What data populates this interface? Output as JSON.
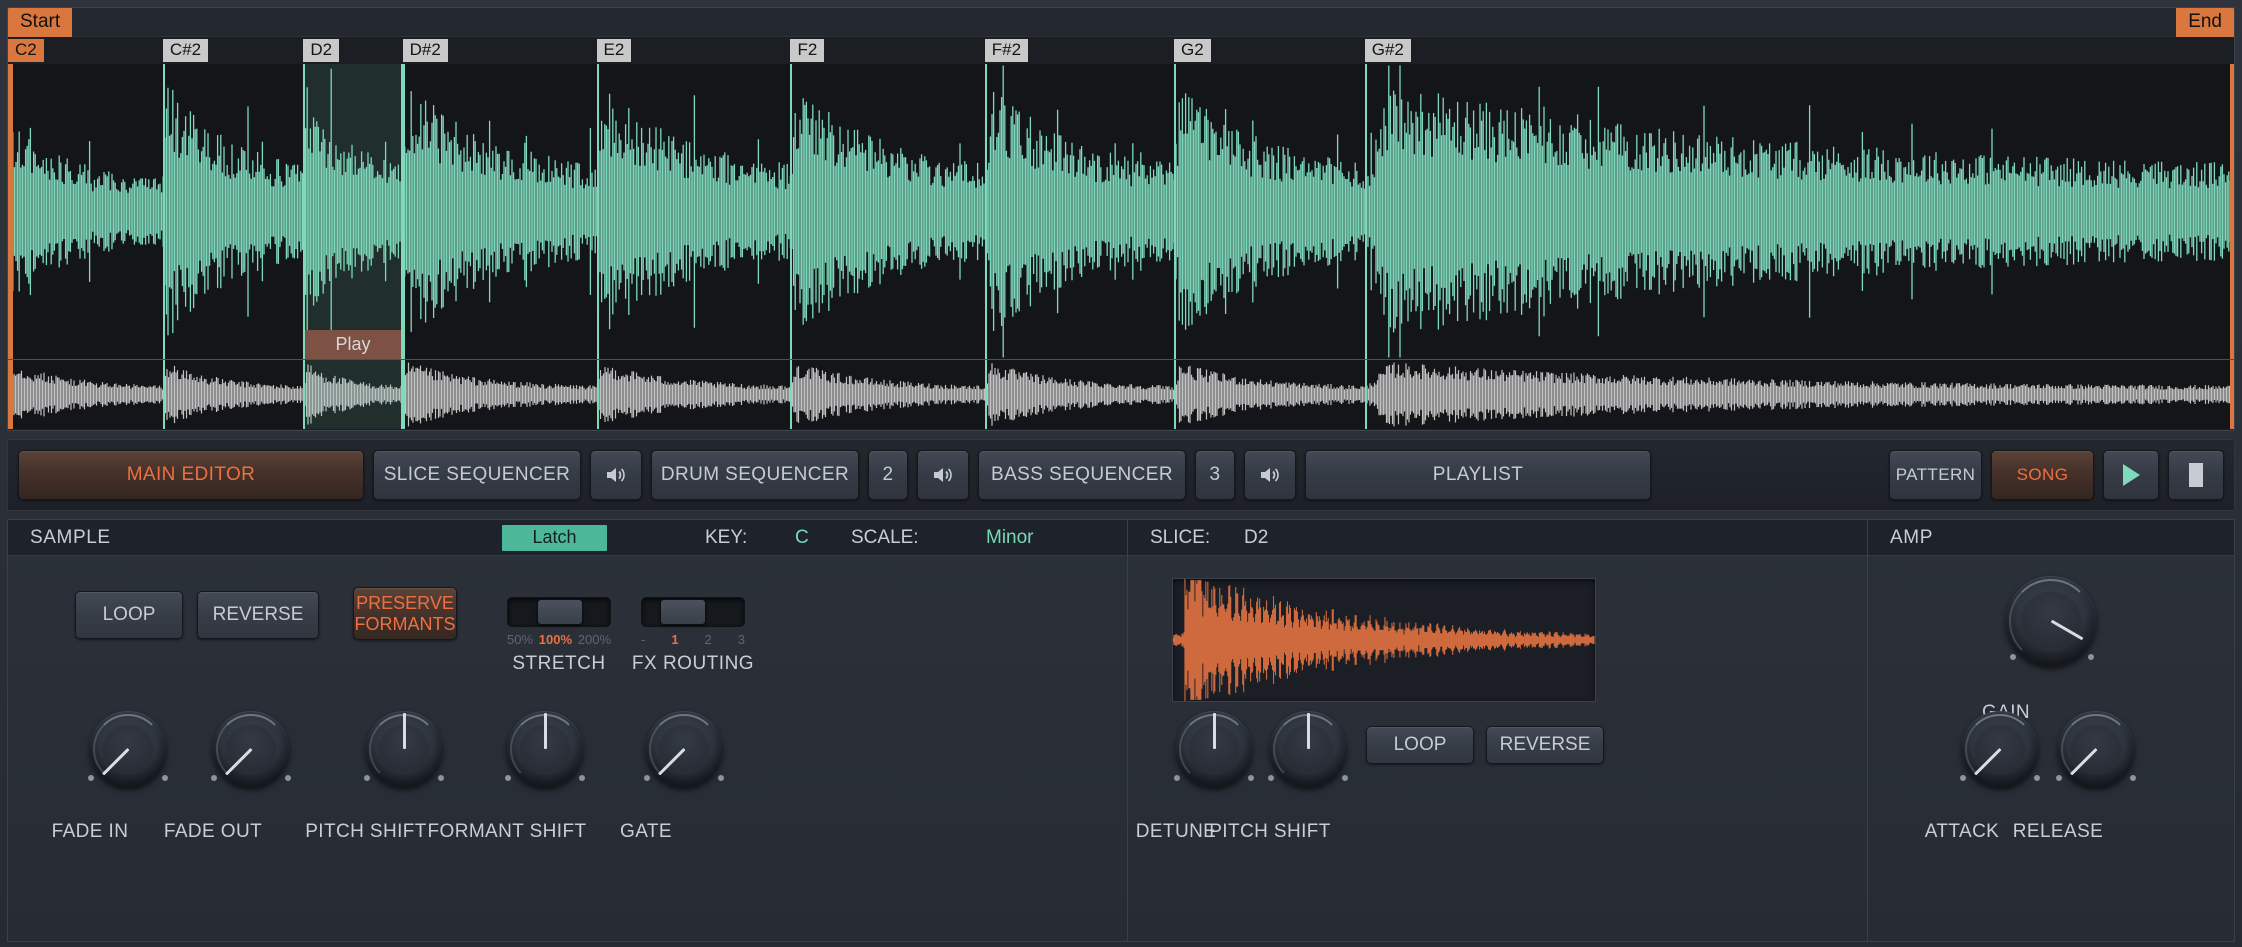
{
  "colors": {
    "accent_orange": "#d9773f",
    "accent_orange_text": "#ec7041",
    "accent_teal": "#7fd9bb",
    "latch_green": "#4db79a",
    "waveform_teal": "#7fd9bb",
    "waveform_gray": "#c3c3c3",
    "slice_wave_orange": "#cf6a3e",
    "panel_bg": "#2b3039",
    "wave_bg": "#131518"
  },
  "waveform": {
    "start_label": "Start",
    "end_label": "End",
    "play_label": "Play",
    "slices": [
      {
        "label": "C2",
        "pos_pct": 0.0,
        "active": true
      },
      {
        "label": "C#2",
        "pos_pct": 6.96,
        "active": false
      },
      {
        "label": "D2",
        "pos_pct": 13.27,
        "active": false
      },
      {
        "label": "D#2",
        "pos_pct": 17.73,
        "active": false
      },
      {
        "label": "E2",
        "pos_pct": 26.44,
        "active": false
      },
      {
        "label": "F2",
        "pos_pct": 35.15,
        "active": false
      },
      {
        "label": "F#2",
        "pos_pct": 43.88,
        "active": false
      },
      {
        "label": "G2",
        "pos_pct": 52.38,
        "active": false
      },
      {
        "label": "G#2",
        "pos_pct": 60.95,
        "active": false
      }
    ],
    "selection": {
      "start_pct": 13.27,
      "end_pct": 17.73
    }
  },
  "toolbar": {
    "tabs": [
      {
        "label": "MAIN EDITOR",
        "active": true,
        "kind": "wide"
      },
      {
        "label": "SLICE SEQUENCER",
        "active": false,
        "kind": "mid"
      },
      {
        "label": "DRUM SEQUENCER",
        "active": false,
        "kind": "mid"
      },
      {
        "label": "BASS SEQUENCER",
        "active": false,
        "kind": "mid"
      },
      {
        "label": "PLAYLIST",
        "active": false,
        "kind": "wide"
      }
    ],
    "drum_count": "2",
    "bass_count": "3",
    "speaker_icon": "speaker-icon",
    "pattern_label": "PATTERN",
    "song_label": "SONG",
    "play_icon": "play-icon",
    "stop_icon": "stop-icon"
  },
  "sample": {
    "title": "SAMPLE",
    "latch_label": "Latch",
    "key_label": "KEY:",
    "key_value": "C",
    "scale_label": "SCALE:",
    "scale_value": "Minor",
    "loop_label": "LOOP",
    "reverse_label": "REVERSE",
    "preserve_formants_line1": "PRESERVE",
    "preserve_formants_line2": "FORMANTS",
    "stretch": {
      "label": "STRETCH",
      "ticks": [
        "50%",
        "100%",
        "200%"
      ],
      "selected_index": 1
    },
    "fx_routing": {
      "label": "FX ROUTING",
      "ticks": [
        "-",
        "1",
        "2",
        "3"
      ],
      "selected_index": 1
    },
    "knobs": [
      {
        "label": "FADE IN",
        "angle": -135
      },
      {
        "label": "FADE OUT",
        "angle": -135
      },
      {
        "label": "PITCH SHIFT",
        "angle": 0
      },
      {
        "label": "FORMANT SHIFT",
        "angle": 0
      },
      {
        "label": "GATE",
        "angle": -135
      }
    ]
  },
  "slice": {
    "title": "SLICE:",
    "value": "D2",
    "loop_label": "LOOP",
    "reverse_label": "REVERSE",
    "knobs": [
      {
        "label": "DETUNE",
        "angle": 0
      },
      {
        "label": "PITCH SHIFT",
        "angle": 0
      }
    ]
  },
  "amp": {
    "title": "AMP",
    "knobs": [
      {
        "label": "GAIN",
        "angle": 120
      },
      {
        "label": "ATTACK",
        "angle": -135
      },
      {
        "label": "RELEASE",
        "angle": -135
      }
    ]
  }
}
